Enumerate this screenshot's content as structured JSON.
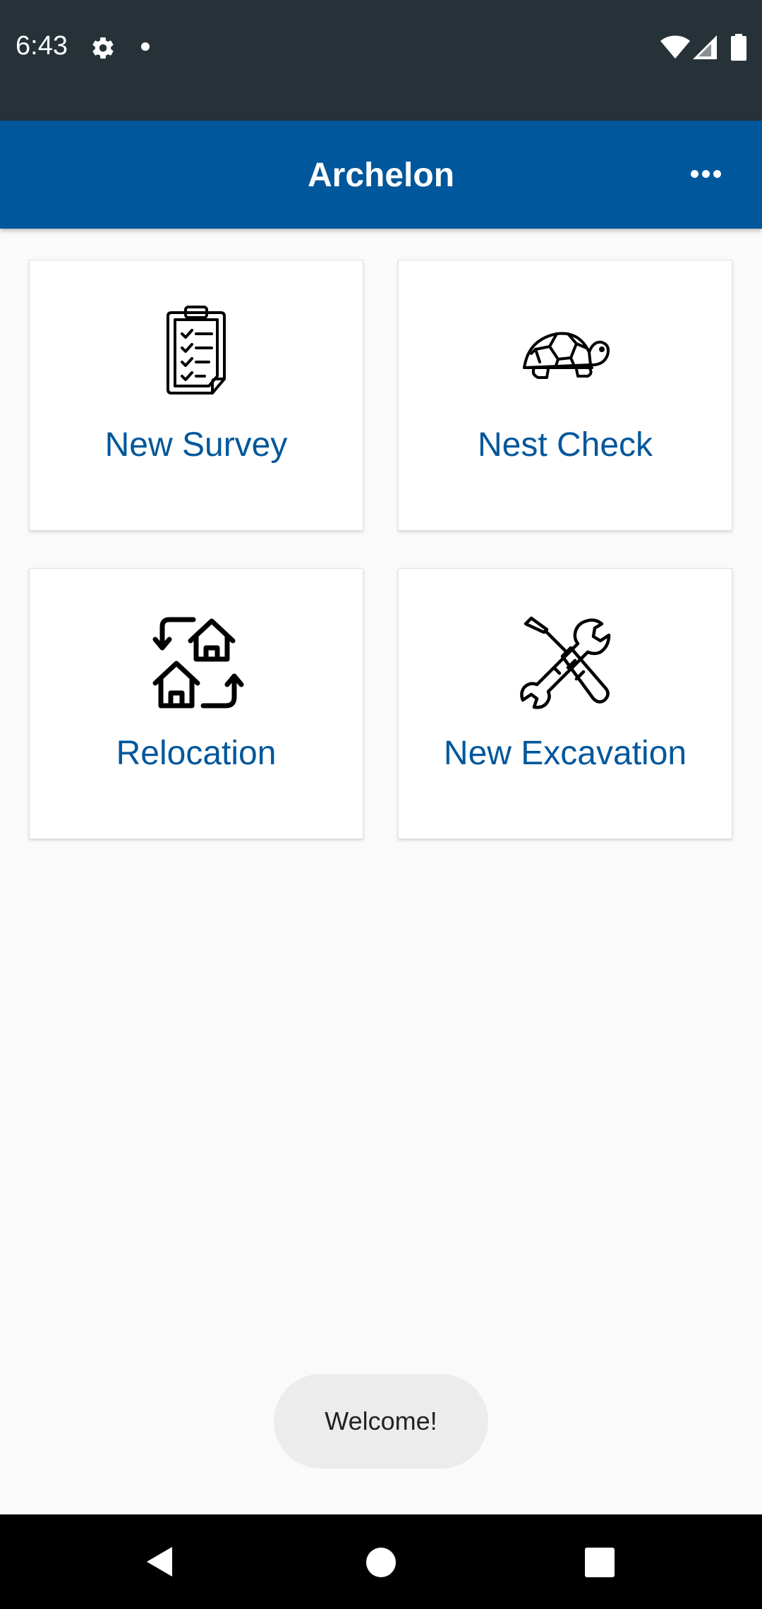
{
  "status_bar": {
    "time": "6:43",
    "icons": [
      "settings-gear-icon",
      "notification-dot-icon",
      "wifi-icon",
      "cell-signal-icon",
      "battery-icon"
    ]
  },
  "app_bar": {
    "title": "Archelon",
    "overflow_icon": "more-horizontal-icon"
  },
  "menu": {
    "cards": [
      {
        "label": "New Survey",
        "icon": "clipboard-checklist-icon"
      },
      {
        "label": "Nest Check",
        "icon": "turtle-icon"
      },
      {
        "label": "Relocation",
        "icon": "houses-swap-icon"
      },
      {
        "label": "New Excavation",
        "icon": "wrench-screwdriver-icon"
      }
    ]
  },
  "toast": {
    "text": "Welcome!"
  },
  "nav_bar": {
    "icons": [
      "back-icon",
      "home-icon",
      "recents-icon"
    ]
  },
  "colors": {
    "status_bar": "#263238",
    "app_bar": "#01579b",
    "card_label": "#01579b",
    "background": "#fafafa",
    "toast_bg": "#ececec",
    "nav_bar": "#000000"
  }
}
